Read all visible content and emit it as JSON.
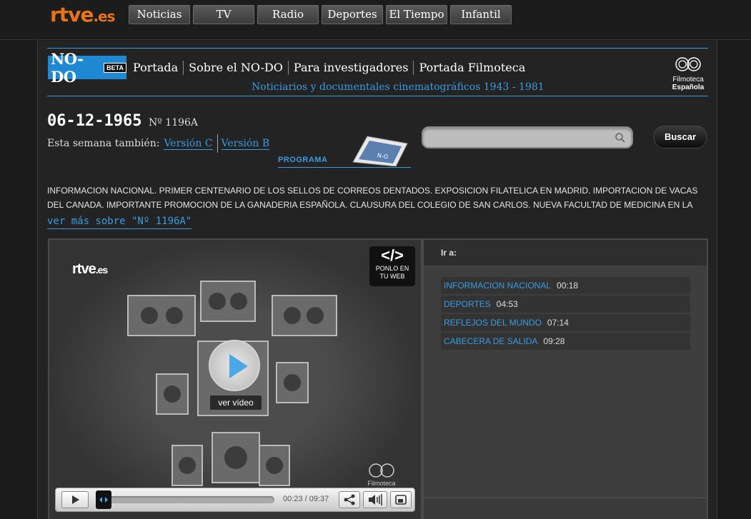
{
  "site": {
    "logo_main": "rtve",
    "logo_suffix": ".es",
    "nav": [
      "Noticias",
      "TV",
      "Radio",
      "Deportes",
      "El Tiempo",
      "Infantil"
    ]
  },
  "section": {
    "logo": "NO-DO",
    "beta": "BETA",
    "nav": [
      "Portada",
      "Sobre el NO-DO",
      "Para investigadores",
      "Portada Filmoteca"
    ],
    "tagline": "Noticiarios y documentales cinematográficos 1943 - 1981",
    "filmoteca_line1": "Filmoteca",
    "filmoteca_line2": "Española"
  },
  "episode": {
    "date": "06-12-1965",
    "number": "Nº 1196A",
    "also_label": "Esta semana también:",
    "version_c": "Versión C",
    "version_b": "Versión B",
    "programa_label": "PROGRAMA",
    "summary": "INFORMACION NACIONAL. PRIMER CENTENARIO DE LOS SELLOS DE CORREOS DENTADOS. EXPOSICION FILATELICA EN MADRID. IMPORTACION DE VACAS DEL CANADA. IMPORTANTE PROMOCION DE LA GANADERIA ESPAÑOLA. CLAUSURA DEL COLEGIO DE SAN CARLOS. NUEVA FACULTAD DE MEDICINA EN LA",
    "ver_mas": "ver más sobre \"Nº 1196A\""
  },
  "search": {
    "placeholder": "",
    "button": "Buscar"
  },
  "player": {
    "logo_main": "rtve",
    "logo_suffix": ".es",
    "embed_symbol": "</>",
    "embed_line1": "PONLO EN",
    "embed_line2": "TU WEB",
    "ver_video": "ver vídeo",
    "watermark": "Filmoteca",
    "time": "00:23 / 09:37",
    "progress_fraction": 0.04
  },
  "chapters": {
    "heading": "Ir a:",
    "items": [
      {
        "name": "INFORMACION NACIONAL",
        "time": "00:18"
      },
      {
        "name": "DEPORTES",
        "time": "04:53"
      },
      {
        "name": "REFLEJOS DEL MUNDO",
        "time": "07:14"
      },
      {
        "name": "CABECERA DE SALIDA",
        "time": "09:28"
      }
    ]
  },
  "colors": {
    "brand_orange": "#e8741a",
    "accent_blue": "#3a9be0",
    "play_blue": "#4aa9e4"
  }
}
